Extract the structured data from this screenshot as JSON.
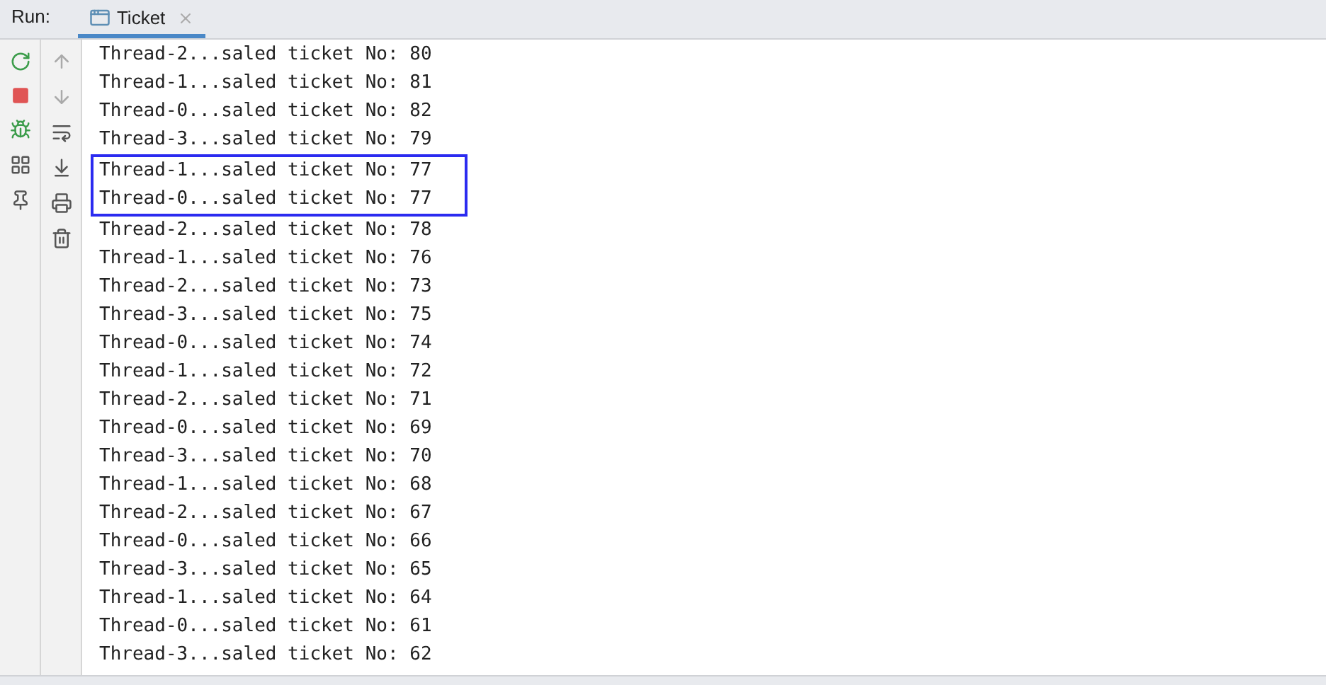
{
  "tool_window": {
    "label": "Run:",
    "tab": {
      "title": "Ticket",
      "selected": true
    }
  },
  "console_lines": [
    {
      "text": "Thread-2...saled ticket No: 80",
      "highlighted": false
    },
    {
      "text": "Thread-1...saled ticket No: 81",
      "highlighted": false
    },
    {
      "text": "Thread-0...saled ticket No: 82",
      "highlighted": false
    },
    {
      "text": "Thread-3...saled ticket No: 79",
      "highlighted": false
    },
    {
      "text": "Thread-1...saled ticket No: 77",
      "highlighted": true
    },
    {
      "text": "Thread-0...saled ticket No: 77",
      "highlighted": true
    },
    {
      "text": "Thread-2...saled ticket No: 78",
      "highlighted": false
    },
    {
      "text": "Thread-1...saled ticket No: 76",
      "highlighted": false
    },
    {
      "text": "Thread-2...saled ticket No: 73",
      "highlighted": false
    },
    {
      "text": "Thread-3...saled ticket No: 75",
      "highlighted": false
    },
    {
      "text": "Thread-0...saled ticket No: 74",
      "highlighted": false
    },
    {
      "text": "Thread-1...saled ticket No: 72",
      "highlighted": false
    },
    {
      "text": "Thread-2...saled ticket No: 71",
      "highlighted": false
    },
    {
      "text": "Thread-0...saled ticket No: 69",
      "highlighted": false
    },
    {
      "text": "Thread-3...saled ticket No: 70",
      "highlighted": false
    },
    {
      "text": "Thread-1...saled ticket No: 68",
      "highlighted": false
    },
    {
      "text": "Thread-2...saled ticket No: 67",
      "highlighted": false
    },
    {
      "text": "Thread-0...saled ticket No: 66",
      "highlighted": false
    },
    {
      "text": "Thread-3...saled ticket No: 65",
      "highlighted": false
    },
    {
      "text": "Thread-1...saled ticket No: 64",
      "highlighted": false
    },
    {
      "text": "Thread-0...saled ticket No: 61",
      "highlighted": false
    },
    {
      "text": "Thread-3...saled ticket No: 62",
      "highlighted": false
    }
  ]
}
